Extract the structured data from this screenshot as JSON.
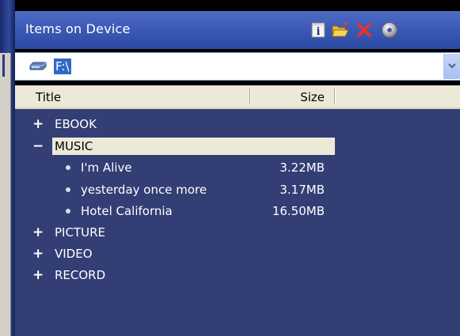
{
  "header": {
    "title": "Items on Device",
    "icons": [
      "info-icon",
      "open-folder-icon",
      "delete-icon",
      "disc-icon"
    ]
  },
  "path_bar": {
    "value": "F:\\"
  },
  "columns": {
    "title": "Title",
    "size": "Size"
  },
  "tree": {
    "ebook": {
      "expander": "+",
      "label": "EBOOK"
    },
    "music": {
      "expander": "−",
      "label": "MUSIC",
      "items": [
        {
          "title": "I'm Alive",
          "size": "3.22MB"
        },
        {
          "title": "yesterday once more",
          "size": "3.17MB"
        },
        {
          "title": "Hotel California",
          "size": "16.50MB"
        }
      ]
    },
    "picture": {
      "expander": "+",
      "label": "PICTURE"
    },
    "video": {
      "expander": "+",
      "label": "VIDEO"
    },
    "record": {
      "expander": "+",
      "label": "RECORD"
    }
  },
  "colors": {
    "header": "#3a59b5",
    "tree_background": "#323e74",
    "selection": "#ece9d8",
    "path_highlight": "#316ac5"
  }
}
